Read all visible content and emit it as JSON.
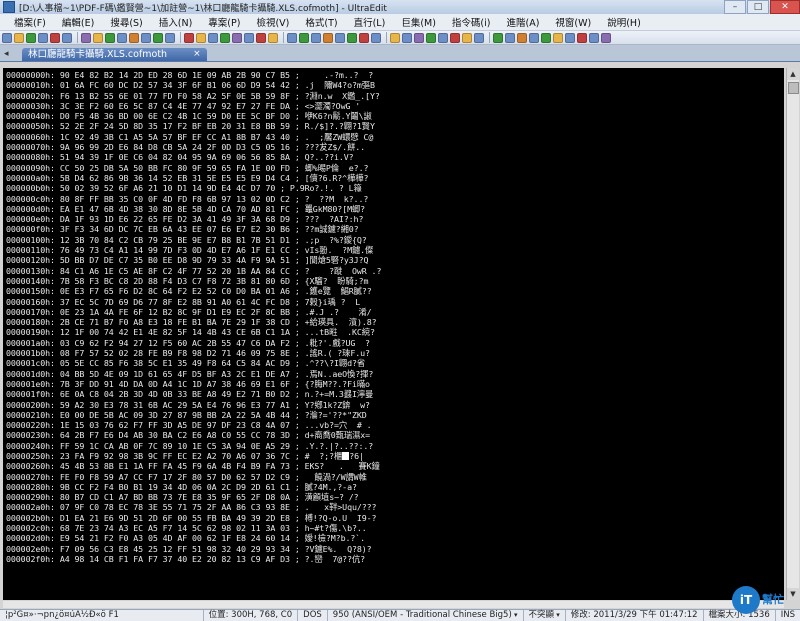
{
  "window": {
    "title": "[D:\\人事檔~1\\PDF-F碼\\鑑賢營~1\\加註營~1\\林口廳龍騎卡攝騎.XLS.cofmoth] - UltraEdit",
    "buttons": [
      "–",
      "□",
      "✕"
    ]
  },
  "menu": [
    "檔案(F)",
    "編輯(E)",
    "搜尋(S)",
    "插入(N)",
    "專案(P)",
    "檢視(V)",
    "格式(T)",
    "直行(L)",
    "巨集(M)",
    "指令碼(i)",
    "進階(A)",
    "視窗(W)",
    "說明(H)"
  ],
  "toolbar_colors": [
    "#6d8fc8",
    "#e7b548",
    "#3c9a3c",
    "#6d8fc8",
    "#c04040",
    "#6d8fc8",
    "#8a6db0",
    "#e7b548",
    "#3c9a3c",
    "#6d8fc8",
    "#d08030",
    "#6d8fc8",
    "#3c9a3c",
    "#6d8fc8",
    "#c04040",
    "#e7b548",
    "#6d8fc8",
    "#3c9a3c",
    "#8a6db0",
    "#6d8fc8",
    "#c04040",
    "#e7b548",
    "#6d8fc8",
    "#3c9a3c",
    "#6d8fc8",
    "#d08030",
    "#6d8fc8",
    "#3c9a3c",
    "#c04040",
    "#6d8fc8",
    "#e7b548",
    "#6d8fc8",
    "#8a6db0",
    "#3c9a3c",
    "#6d8fc8",
    "#c04040",
    "#e7b548",
    "#6d8fc8",
    "#3c9a3c",
    "#6d8fc8",
    "#d08030",
    "#6d8fc8",
    "#3c9a3c",
    "#e7b548",
    "#6d8fc8",
    "#c04040",
    "#6d8fc8",
    "#8a6db0"
  ],
  "tab": {
    "label": "林口廳龍騎卡攝騎.XLS.cofmoth",
    "close": "×"
  },
  "hex_lines": [
    "00000000h: 90 E4 82 B2 14 2D ED 28 6D 1E 09 AB 2B 90 C7 B5 ;     .-?m..?  ?",
    "00000010h: 01 6A FC 60 DC D2 57 34 3F 6F B1 06 6D D9 54 42 ; .j  隬W4?o?m彄B",
    "00000020h: F6 13 B2 55 6E 01 77 FD F0 58 A2 5F 0E 5B 59 8F ; ?淵n.w  X鑑_.[Y?",
    "00000030h: 3C 3E F2 60 E6 5C 87 C4 4E 77 47 92 E7 27 FE DA ; <>澀濁?OwG '",
    "00000040h: D0 F5 4B 36 BD 00 6E C2 4B 1C 59 D0 EE 5C BF D0 ; 咿K6?n鬋.Y鬮\\諔",
    "00000050h: 52 2E 2F 24 5D 8D 35 17 F2 BF EB 20 31 E8 BB 59 ; R./$]?.?翺?1贀Y",
    "00000060h: 1C 92 49 3B C1 A5 5A 57 BF EF CC A1 8B B7 43 40 ; .  ;饜ZW蠉憵 C@",
    "00000070h: 9A 96 99 2D E6 84 D8 CB 5A 24 2F 0D D3 C5 05 16 ; ???犮Z$/.餅..",
    "00000080h: 51 94 39 1F 0E C6 04 82 04 95 9A 69 06 56 85 8A ; Q?..??i.V?",
    "00000090h: CC 50 25 DB 5A 50 BB FC 80 9F 59 65 FA 1E 00 FD ; 蝍%晹P倫  e?.?",
    "000000a0h: 5B D4 62 86 9B 36 14 52 EB 31 5E E5 E5 E9 D4 C4 ; [儥?6.R?^樺樺?",
    "000000b0h: 50 02 39 52 6F A6 21 10 D1 14 9D E4 4C D7 70 ; P.9Ro?.!. ? L簶",
    "000000c0h: 80 8F FF BB 35 C0 0F 4D FD F8 6B 97 13 02 0D C2 ; ?  ??M  k?..?",
    "000000d0h: EA E1 47 6B 4D 38 30 8D 8E 5B 4D CA 70 AD 81 FC ; 鼉GkM80?[M蝍?",
    "000000e0h: DA 1F 93 1D E6 22 65 FE D2 3A 41 49 3F 3A 68 D9 ; ???  ?AI?:h?",
    "000000f0h: 3F F3 34 6D DC 7C EB 6A 43 EE 07 E6 E7 E2 30 B6 ; ??m誠鑢?緗0?",
    "00000100h: 12 3B 70 84 C2 CB 79 25 BE 9E E7 B8 B1 7B 51 D1 ; .;p  ?%?鑀{Q?",
    "00000110h: 76 49 73 C4 A1 14 99 7D F3 0D 4D E7 A6 1F E1 CC ; vIs翂.  ?M鑢.儏",
    "00000120h: 5D BB D7 DE C7 35 B0 EE D8 9D 79 33 4A F9 9A 51 ; ]閬熗5硻?y3J?Q",
    "00000130h: 84 C1 A6 1E C5 AE 8F C2 4F 77 52 20 1B AA 84 CC ; ?    ?蹝  OwR .?",
    "00000140h: 7B 58 F3 BC C8 2D 88 F4 D3 C7 F8 72 3B 81 80 6D ; {X騮?  盼騎;?m",
    "00000150h: 0E E3 F7 65 F6 D2 8C 64 F2 E2 52 C0 D0 BA 01 A6 ; .鑊e覽  鯧R膩??",
    "00000160h: 37 EC 5C 7D 69 D6 77 8F E2 8B 91 A0 61 4C FC D8 ; 7榖}i瑀 ?  L",
    "00000170h: 0E 23 1A 4A FE 6F 12 B2 8C 9F D1 E9 EC 2F 8C BB ; .#.J .?    淆/",
    "00000180h: 2B CE 71 B7 F0 A8 E3 18 FE B1 BA 7E 29 1F 38 CD ; +給瑛具.  濱).8?",
    "00000190h: 12 1F 00 74 42 E1 4E 82 5F 14 4B 43 CE 6B C1 1A ; ...tB暀  .KC綂?",
    "000001a0h: 03 C9 62 F2 94 27 12 F5 60 AC 2B 55 47 C6 DA F2 ; .粃?'.戲?UG  ?",
    "000001b0h: 08 F7 57 52 02 28 FE B9 F8 98 D2 71 46 09 75 8E ; .謠R.( ?琜F.u?",
    "000001c0h: 05 5E CC 85 F6 38 5C E1 35 49 F8 64 C5 84 AC D9 ; .^??\\?I翺d?省",
    "000001d0h: 04 BB 5D 4E 09 1D 61 65 4F D5 BF A3 2C E1 DE A7 ; .焉N..aeO愌?揮?",
    "000001e0h: 7B 3F DD 91 4D DA 0D A4 1C 1D A7 38 46 69 E1 6F ; {?脢M??.?Fi暪o",
    "000001f0h: 6E 0A C8 04 2B 3D 4D 0B 33 BE A8 49 E2 71 B0 D2 ; n.?+=M.3鼝I濘曼",
    "00000200h: 59 A2 30 E3 78 31 6B AC 29 5A E4 76 96 E3 77 A1 ; Y?鄕1k?Z錛  w?",
    "00000210h: E0 00 DE 5B AC 09 3D 27 87 9B BB 2A 22 5A 4B 44 ; ?溣?='??*\"ZKD",
    "00000220h: 1E 15 03 76 62 F7 FF 3D A5 DE 97 DF 23 C8 4A 07 ; ...vb?=穴  # .",
    "00000230h: 64 2B F7 E6 D4 AB 30 BA C2 E6 A8 C0 55 CC 78 3D ; d+裔喬0甄瑞濕x=",
    "00000240h: FF 59 1C CA AB 0F 7C 89 10 1E C5 3A 94 0E A5 29 ; .Y.?.|?..??:.?",
    "00000250h: 23 FA F9 92 98 3B 9C FF EC E2 A2 70 A6 07 36 7C ; #  ?;?櫃[[CURSOR]]?6|",
    "00000260h: 45 4B 53 8B E1 1A FF FA 45 F9 6A 4B F4 B9 FA 73 ; EKS?   .   賽K鐘",
    "00000270h: FE F0 F8 59 A7 CC F7 17 2F 80 57 D0 62 57 D2 C9 ;   饒渦?/W謂W帷",
    "00000280h: 9B CC F2 F4 B0 B1 19 34 4D 06 0A 2C D9 2D 61 C1 ; 膩?4M.,?-a?",
    "00000290h: 80 B7 CD C1 A7 BD BB 73 7E E8 35 9F 65 2F D8 0A ; 潢顧埴s~? /?",
    "000002a0h: 07 9F C0 78 EC 78 3E 55 71 75 2F AA 86 C3 93 8E ; .   x靽>Uqu/???",
    "000002b0h: D1 EA 21 E6 9D 51 2D 6F 00 55 FB BA 49 39 2D E8 ; 榑!?Q-o.U  I9-?",
    "000002c0h: 68 7E 23 74 A3 EC A5 F7 14 5C 62 98 02 11 3A 03 ; h~#t?傷.\\b?..",
    "000002d0h: E9 54 21 F2 F0 A3 05 4D AF 00 62 1F E8 24 60 14 ; 嬡!檢?M?b.?`.",
    "000002e0h: F7 09 56 C3 E8 45 25 12 FF 51 98 32 40 29 93 34 ; ?V鑢E%.  Q?8)?",
    "000002f0h: A4 98 14 CB F1 FA F7 37 40 E2 20 82 13 C9 AF D3 ; ?.巒  7@??伉?"
  ],
  "status": {
    "left": "¦p²G¤»·¬pn¿ö¤úA½Ð«ö F1",
    "position": "位置: 300H, 768, C0",
    "format": "DOS",
    "encoding": "950  (ANSI/OEM - Traditional Chinese Big5)",
    "readonly": "不突顯",
    "modified": "修改: 2011/3/29 下午 01:47:12",
    "filesize": "檔案大小: 1536",
    "mode": "INS"
  },
  "watermark": {
    "logo": "iT",
    "text": "幫忙"
  }
}
